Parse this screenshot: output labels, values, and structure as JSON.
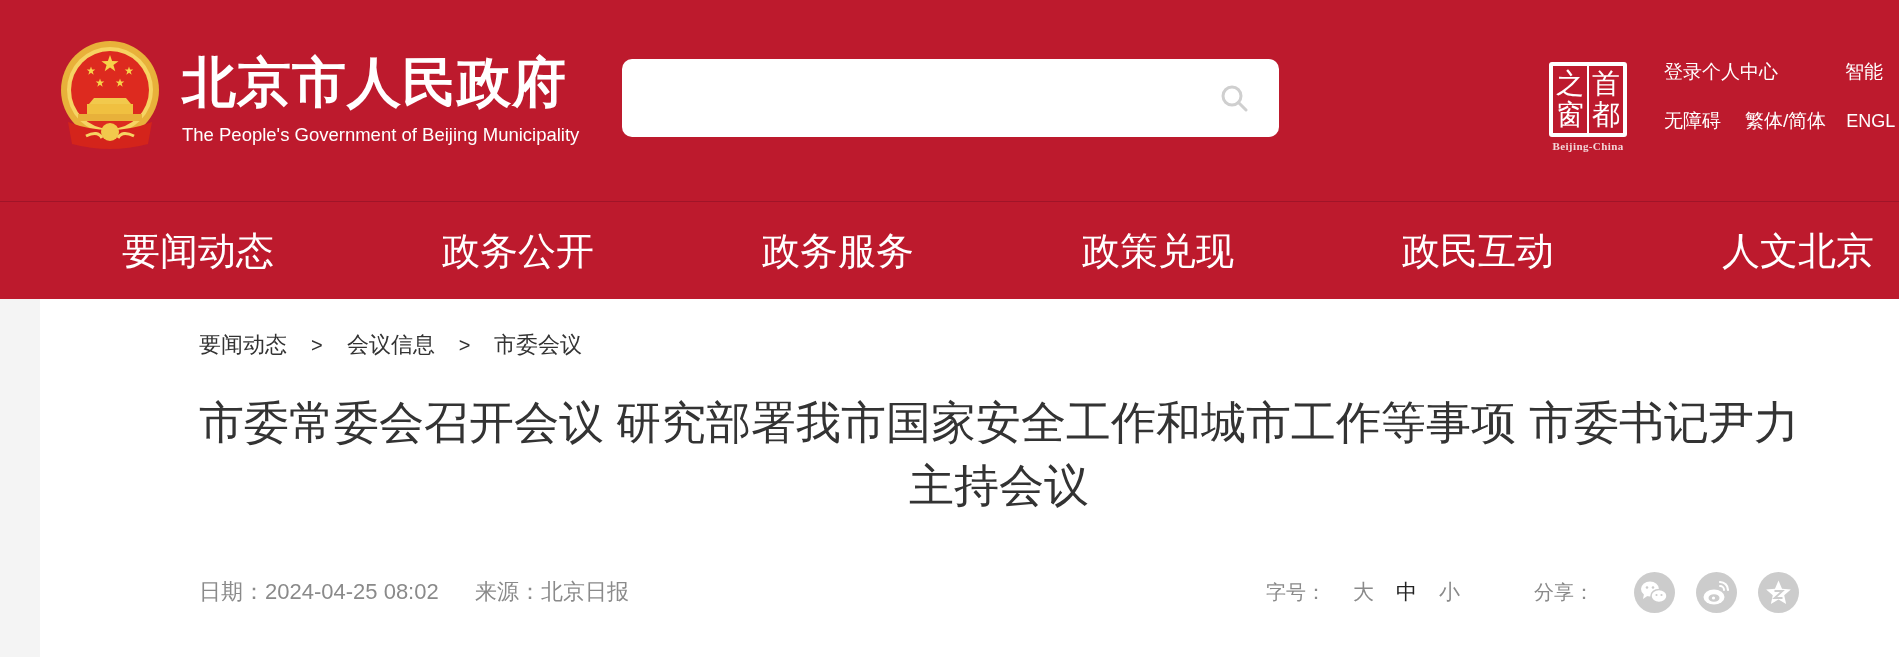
{
  "header": {
    "title": "北京市人民政府",
    "subtitle": "The People's Government of Beijing Municipality"
  },
  "seal": {
    "columns": [
      "之窗",
      "首都"
    ],
    "caption": "Beijing-China"
  },
  "top_links": [
    [
      "登录个人中心",
      "智能"
    ],
    [
      "无障碍",
      "繁体/简体",
      "ENGL"
    ]
  ],
  "nav": [
    "要闻动态",
    "政务公开",
    "政务服务",
    "政策兑现",
    "政民互动",
    "人文北京"
  ],
  "breadcrumb": [
    {
      "kind": "link",
      "label": "要闻动态"
    },
    {
      "kind": "separator",
      "label": ">"
    },
    {
      "kind": "link",
      "label": "会议信息"
    },
    {
      "kind": "separator",
      "label": ">"
    },
    {
      "kind": "link",
      "label": "市委会议"
    }
  ],
  "article": {
    "title": "市委常委会召开会议 研究部署我市国家安全工作和城市工作等事项 市委书记尹力主持会议",
    "date": "日期：2024-04-25 08:02",
    "source": "来源：北京日报"
  },
  "font_size": {
    "label": "字号：",
    "options": [
      {
        "label": "大",
        "selected": false
      },
      {
        "label": "中",
        "selected": true
      },
      {
        "label": "小",
        "selected": false
      }
    ]
  },
  "share": {
    "label": "分享：",
    "buttons": [
      {
        "kind": "chat"
      },
      {
        "kind": "swirl"
      },
      {
        "kind": "star"
      }
    ]
  }
}
